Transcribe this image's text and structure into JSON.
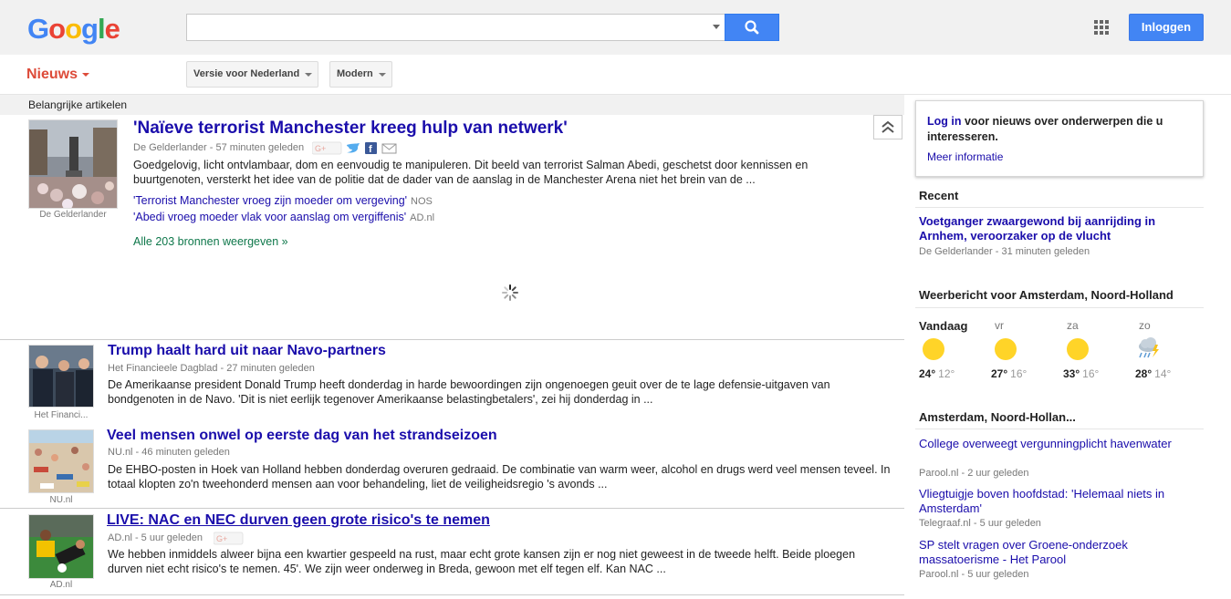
{
  "header": {
    "logo": "Google",
    "search": {
      "value": "",
      "placeholder": ""
    },
    "login_label": "Inloggen"
  },
  "subnav": {
    "section_label": "Nieuws",
    "edition_label": "Versie voor Nederland",
    "mode_label": "Modern"
  },
  "section_title": "Belangrijke artikelen",
  "top_story": {
    "title": "'Naïeve terrorist Manchester kreeg hulp van netwerk'",
    "meta": "De Gelderlander - 57 minuten geleden",
    "snippet": "Goedgelovig, licht ontvlambaar, dom en eenvoudig te manipuleren. Dit beeld van terrorist Salman Abedi, geschetst door kennissen en buurtgenoten, versterkt het idee van de politie dat de dader van de aanslag in de Manchester Arena niet het brein van de ...",
    "image_source": "De Gelderlander",
    "related": [
      {
        "title": "'Terrorist Manchester vroeg zijn moeder om vergeving'",
        "source": "NOS"
      },
      {
        "title": "'Abedi vroeg moeder vlak voor aanslag om vergiffenis'",
        "source": "AD.nl"
      }
    ],
    "all_sources": "Alle 203 bronnen weergeven »"
  },
  "stories": [
    {
      "title": "Trump haalt hard uit naar Navo-partners",
      "meta": "Het Financieele Dagblad - 27 minuten geleden",
      "snippet": "De Amerikaanse president Donald Trump heeft donderdag in harde bewoordingen zijn ongenoegen geuit over de te lage defensie-uitgaven van bondgenoten in de Navo. 'Dit is niet eerlijk tegenover Amerikaanse belastingbetalers', zei hij donderdag in ...",
      "image_source": "Het Financi..."
    },
    {
      "title": "Veel mensen onwel op eerste dag van het strandseizoen",
      "meta": "NU.nl - 46 minuten geleden",
      "snippet": "De EHBO-posten in Hoek van Holland hebben donderdag overuren gedraaid. De combinatie van warm weer, alcohol en drugs werd veel mensen teveel. In totaal klopten zo'n tweehonderd mensen aan voor behandeling, liet de veiligheidsregio 's avonds ...",
      "image_source": "NU.nl"
    },
    {
      "title": "LIVE: NAC en NEC durven geen grote risico's te nemen",
      "meta": "AD.nl - 5 uur geleden",
      "snippet": "We hebben inmiddels alweer bijna een kwartier gespeeld na rust, maar echt grote kansen zijn er nog niet geweest in de tweede helft. Beide ploegen durven niet echt risico's te nemen. 45'. We zijn weer onderweg in Breda, gewoon met elf tegen elf. Kan NAC ...",
      "image_source": "AD.nl"
    }
  ],
  "sidebar": {
    "login_prompt_link": "Log in",
    "login_prompt_text": "voor nieuws over onderwerpen die u interesseren.",
    "more_info": "Meer informatie",
    "recent_heading": "Recent",
    "recent": [
      {
        "title": "Voetganger zwaargewond bij aanrijding in Arnhem, veroorzaker op de vlucht",
        "meta": "De Gelderlander - 31 minuten geleden"
      }
    ],
    "weather_heading": "Weerbericht voor Amsterdam, Noord-Holland",
    "weather": [
      {
        "day": "Vandaag",
        "hi": "24°",
        "lo": "12°",
        "icon": "sun-icon"
      },
      {
        "day": "vr",
        "hi": "27°",
        "lo": "16°",
        "icon": "sun-icon"
      },
      {
        "day": "za",
        "hi": "33°",
        "lo": "16°",
        "icon": "sun-icon"
      },
      {
        "day": "zo",
        "hi": "28°",
        "lo": "14°",
        "icon": "thunderstorm-icon"
      }
    ],
    "local_heading": "Amsterdam, Noord-Hollan...",
    "local": [
      {
        "title": "College overweegt vergunningplicht havenwater",
        "meta": "Parool.nl - 2 uur geleden"
      },
      {
        "title": "Vliegtuigje boven hoofdstad: 'Helemaal niets in Amsterdam'",
        "meta": "Telegraaf.nl - 5 uur geleden"
      },
      {
        "title": "SP stelt vragen over Groene-onderzoek massatoerisme - Het Parool",
        "meta": "Parool.nl - 5 uur geleden"
      }
    ]
  },
  "colors": {
    "brand_blue": "#4285f4",
    "news_red": "#dd4b39",
    "link": "#1a0dab",
    "green_link": "#0e774a",
    "sun": "#ffd428"
  }
}
